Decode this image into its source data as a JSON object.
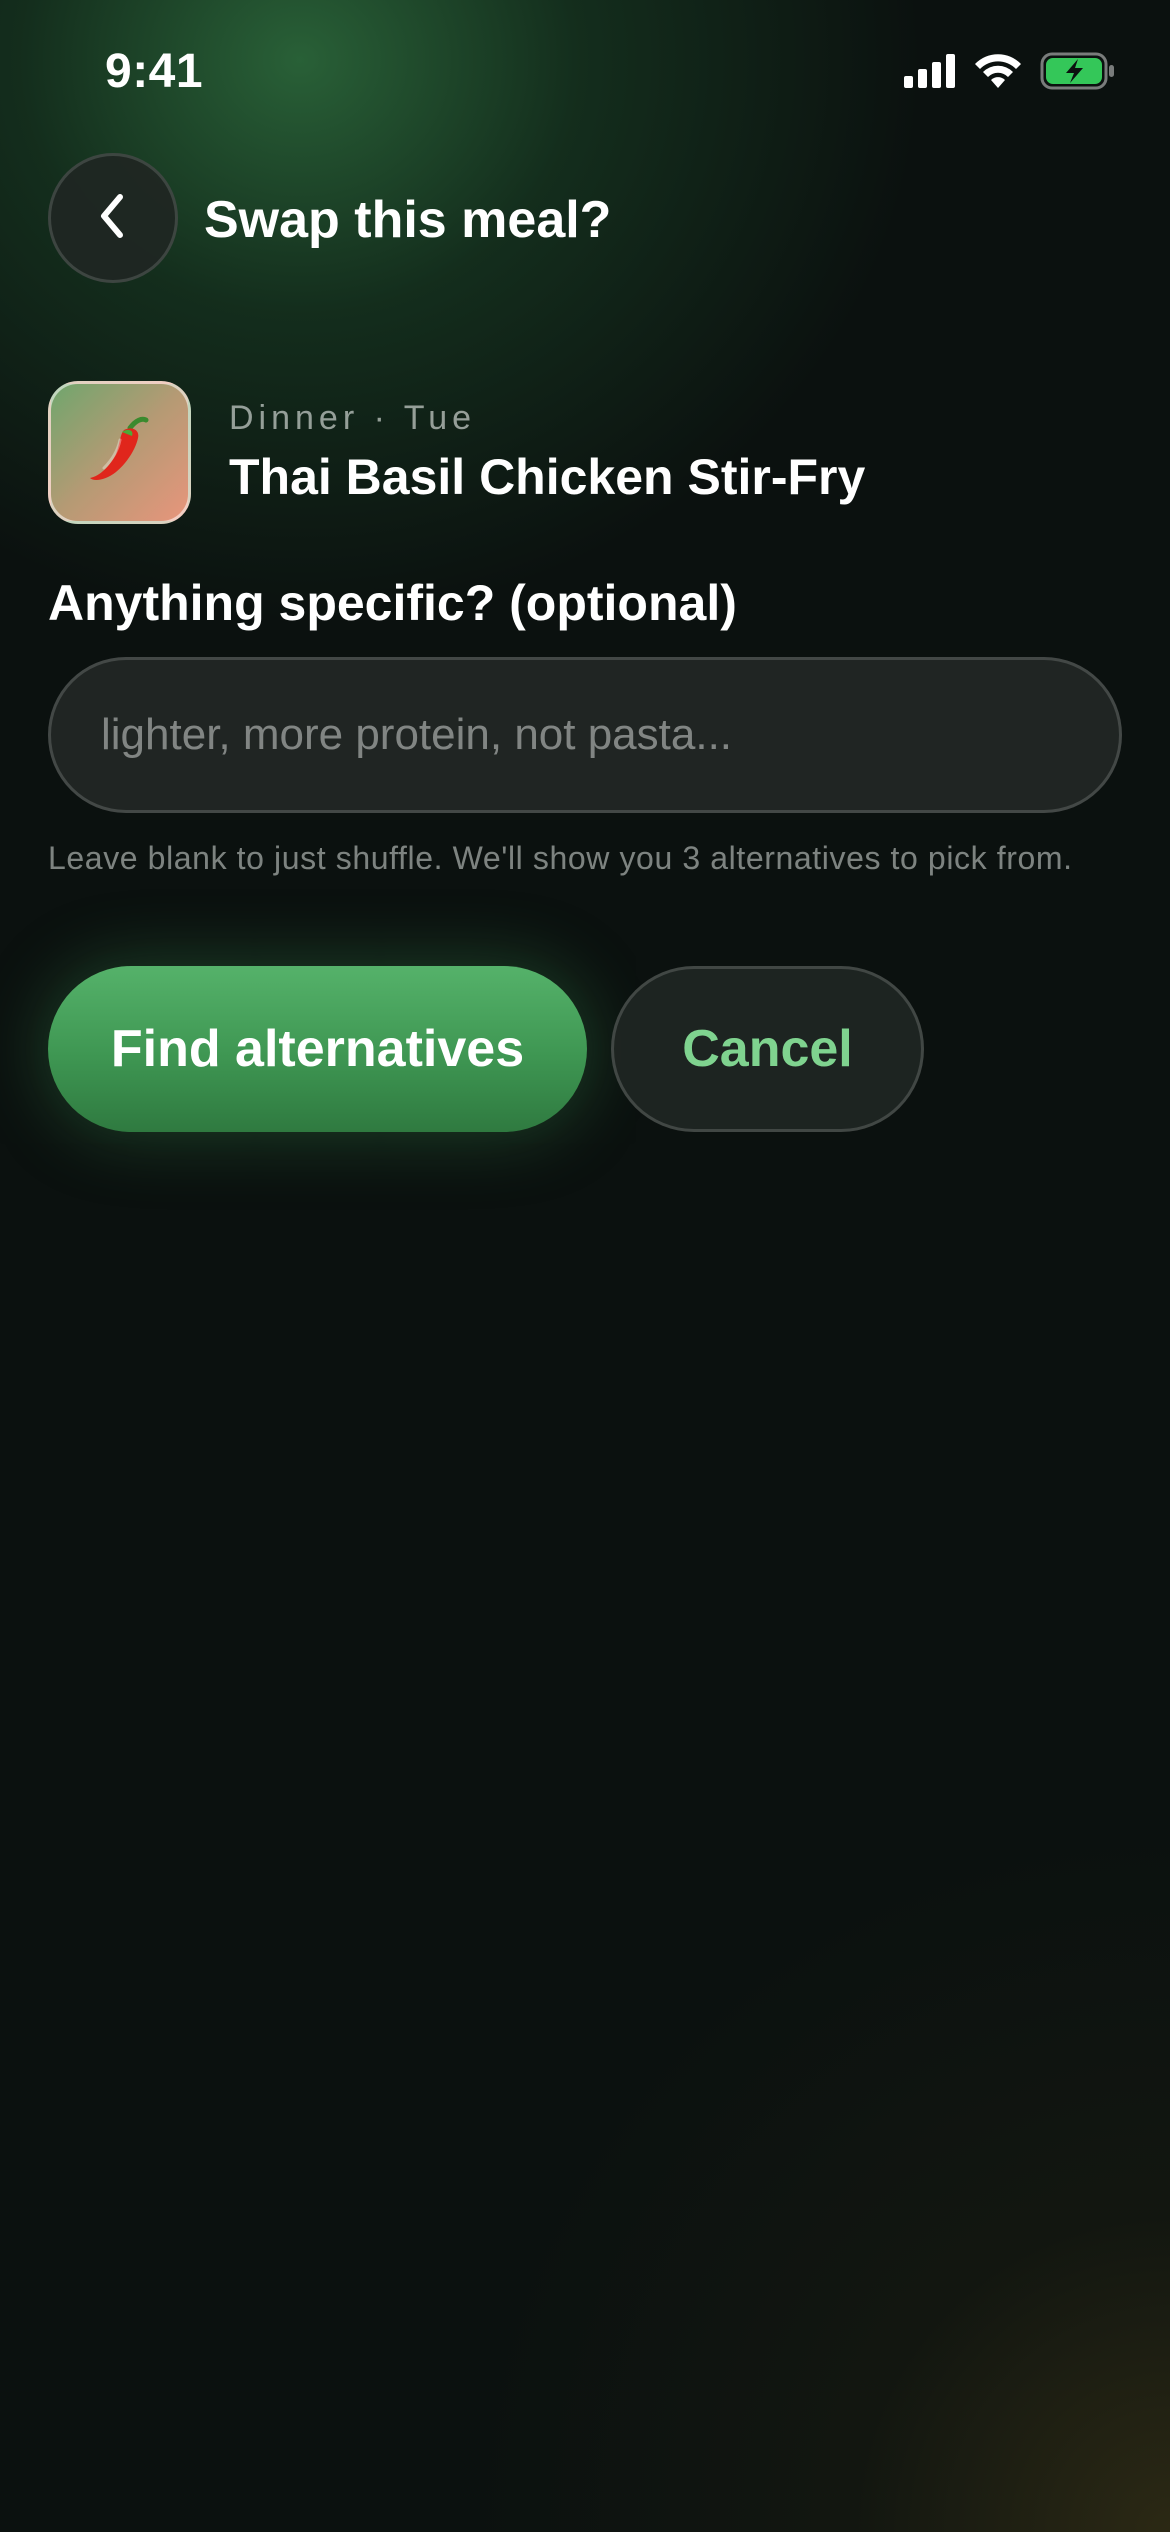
{
  "status_bar": {
    "time": "9:41",
    "icons": [
      "signal-icon",
      "wifi-icon",
      "battery-charging-icon"
    ],
    "battery_color": "#34c759"
  },
  "header": {
    "back_icon": "chevron-left-icon",
    "title": "Swap this meal?"
  },
  "meal": {
    "emoji": "🌶️",
    "meta": "Dinner · Tue",
    "title": "Thai Basil Chicken Stir-Fry"
  },
  "specific": {
    "label": "Anything specific? (optional)",
    "value": "",
    "placeholder": "lighter, more protein, not pasta...",
    "helper": "Leave blank to just shuffle. We'll show you 3 alternatives to pick from."
  },
  "actions": {
    "find_label": "Find alternatives",
    "cancel_label": "Cancel"
  },
  "colors": {
    "accent": "#4caf62",
    "accent_text": "#7fd38f",
    "background": "#0b110f"
  }
}
